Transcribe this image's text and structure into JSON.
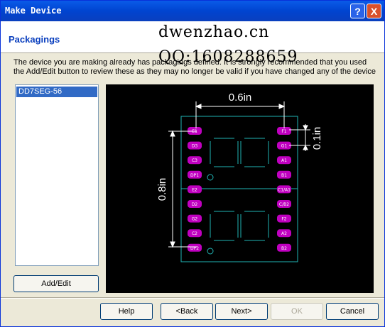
{
  "window": {
    "title": "Make Device",
    "help_glyph": "?",
    "close_glyph": "X"
  },
  "header": {
    "section_title": "Packagings",
    "watermark_line1": "dwenzhao.cn",
    "watermark_line2": "QQ:1608288659"
  },
  "description": "The device you are making already has packagings defined. It is strongly recommended that you used the Add/Edit button to review these as they may no longer be valid if you have changed any of the device",
  "packages": {
    "items": [
      "DD7SEG-56"
    ],
    "selected": "DD7SEG-56"
  },
  "preview": {
    "dim_width": "0.6in",
    "dim_height": "0.8in",
    "dim_pitch": "0.1in",
    "pins_left": [
      "E1",
      "D3",
      "C3",
      "DP1",
      "E2",
      "D2",
      "G2",
      "C2",
      "DP2"
    ],
    "pins_right": [
      "F1",
      "G1",
      "A1",
      "B1",
      "C1/A1",
      "C/B2",
      "F2",
      "A2",
      "B2"
    ],
    "colors": {
      "background": "#000000",
      "outline": "#20b4b4",
      "pad": "#c000c0",
      "dimension": "#ffffff"
    }
  },
  "buttons": {
    "add_edit": "Add/Edit",
    "help": "Help",
    "back": "<Back",
    "next": "Next>",
    "ok": "OK",
    "cancel": "Cancel"
  }
}
